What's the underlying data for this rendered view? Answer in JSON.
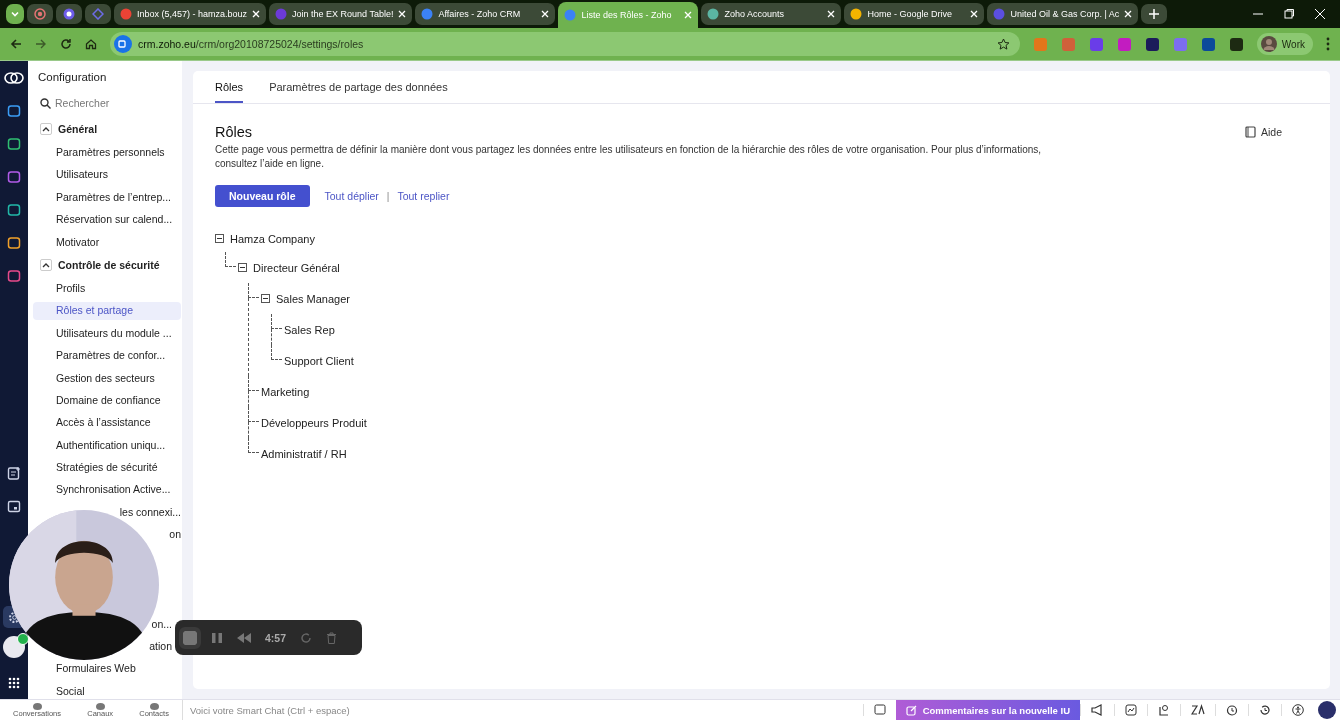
{
  "browser": {
    "tabs": [
      {
        "title": "Inbox (5,457) - hamza.bouz",
        "selected": false
      },
      {
        "title": "Join the EX Round Table!",
        "selected": false
      },
      {
        "title": "Affaires - Zoho CRM",
        "selected": false
      },
      {
        "title": "Liste des Rôles - Zoho",
        "selected": true
      },
      {
        "title": "Zoho Accounts",
        "selected": false
      },
      {
        "title": "Home - Google Drive",
        "selected": false
      },
      {
        "title": "United Oil & Gas Corp. | Ac",
        "selected": false
      }
    ],
    "url_host": "crm.zoho.eu",
    "url_path": "/crm/org20108725024/settings/roles",
    "profile": "Work"
  },
  "sidebar": {
    "title": "Configuration",
    "search": {
      "placeholder": "Rechercher"
    },
    "sections": [
      {
        "title": "Général",
        "expanded": true,
        "items": [
          {
            "label": "Paramètres personnels",
            "selected": false,
            "kind": "item"
          },
          {
            "label": "Utilisateurs",
            "selected": false,
            "kind": "item"
          },
          {
            "label": "Paramètres de l’entrep...",
            "selected": false,
            "kind": "item"
          },
          {
            "label": "Réservation sur calend...",
            "selected": false,
            "kind": "item"
          },
          {
            "label": "Motivator",
            "selected": false,
            "kind": "item"
          }
        ]
      },
      {
        "title": "Contrôle de sécurité",
        "expanded": true,
        "items": [
          {
            "label": "Profils",
            "selected": false,
            "kind": "item"
          },
          {
            "label": "Rôles et partage",
            "selected": true,
            "kind": "item"
          },
          {
            "label": "Utilisateurs du module ...",
            "selected": false,
            "kind": "item"
          },
          {
            "label": "Paramètres de confor...",
            "selected": false,
            "kind": "item"
          },
          {
            "label": "Gestion des secteurs",
            "selected": false,
            "kind": "item"
          },
          {
            "label": "Domaine de confiance",
            "selected": false,
            "kind": "item"
          },
          {
            "label": "Accès à l’assistance",
            "selected": false,
            "kind": "item"
          },
          {
            "label": "Authentification uniqu...",
            "selected": false,
            "kind": "item"
          },
          {
            "label": "Stratégies de sécurité",
            "selected": false,
            "kind": "item"
          },
          {
            "label": "Synchronisation Active...",
            "selected": false,
            "kind": "item"
          },
          {
            "label": "les connexi...",
            "selected": false,
            "kind": "covered"
          },
          {
            "label": "on",
            "selected": false,
            "kind": "covered"
          },
          {
            "label": "on...",
            "selected": false,
            "kind": "covered"
          },
          {
            "label": "ation",
            "selected": false,
            "kind": "covered"
          },
          {
            "label": "Formulaires Web",
            "selected": false,
            "kind": "item"
          },
          {
            "label": "Social",
            "selected": false,
            "kind": "item"
          }
        ]
      }
    ]
  },
  "page": {
    "tabs": [
      {
        "label": "Rôles",
        "selected": true
      },
      {
        "label": "Paramètres de partage des données",
        "selected": false
      }
    ],
    "heading": "Rôles",
    "help": "Aide",
    "description": "Cette page vous permettra de définir la manière dont vous partagez les données entre les utilisateurs en fonction de la hiérarchie des rôles de votre organisation. Pour plus d’informations, consultez l’aide en ligne.",
    "new_button": "Nouveau rôle",
    "links": [
      "Tout déplier",
      "Tout replier"
    ],
    "links_separator": "|",
    "tree": [
      {
        "name": "Hamza Company",
        "expanded": true,
        "children": [
          {
            "name": "Directeur Général",
            "expanded": true,
            "children": [
              {
                "name": "Sales Manager",
                "expanded": true,
                "children": [
                  {
                    "name": "Sales Rep"
                  },
                  {
                    "name": "Support Client"
                  }
                ]
              },
              {
                "name": "Marketing"
              },
              {
                "name": "Développeurs Produit"
              },
              {
                "name": "Administratif / RH"
              }
            ]
          }
        ]
      }
    ]
  },
  "recorder": {
    "time": "4:57"
  },
  "bottom_bar": {
    "nav": [
      "Conversations",
      "Canaux",
      "Contacts"
    ],
    "chat": {
      "placeholder": "Voici votre Smart Chat (Ctrl + espace)"
    },
    "feedback": "Commentaires sur la nouvelle IU"
  }
}
